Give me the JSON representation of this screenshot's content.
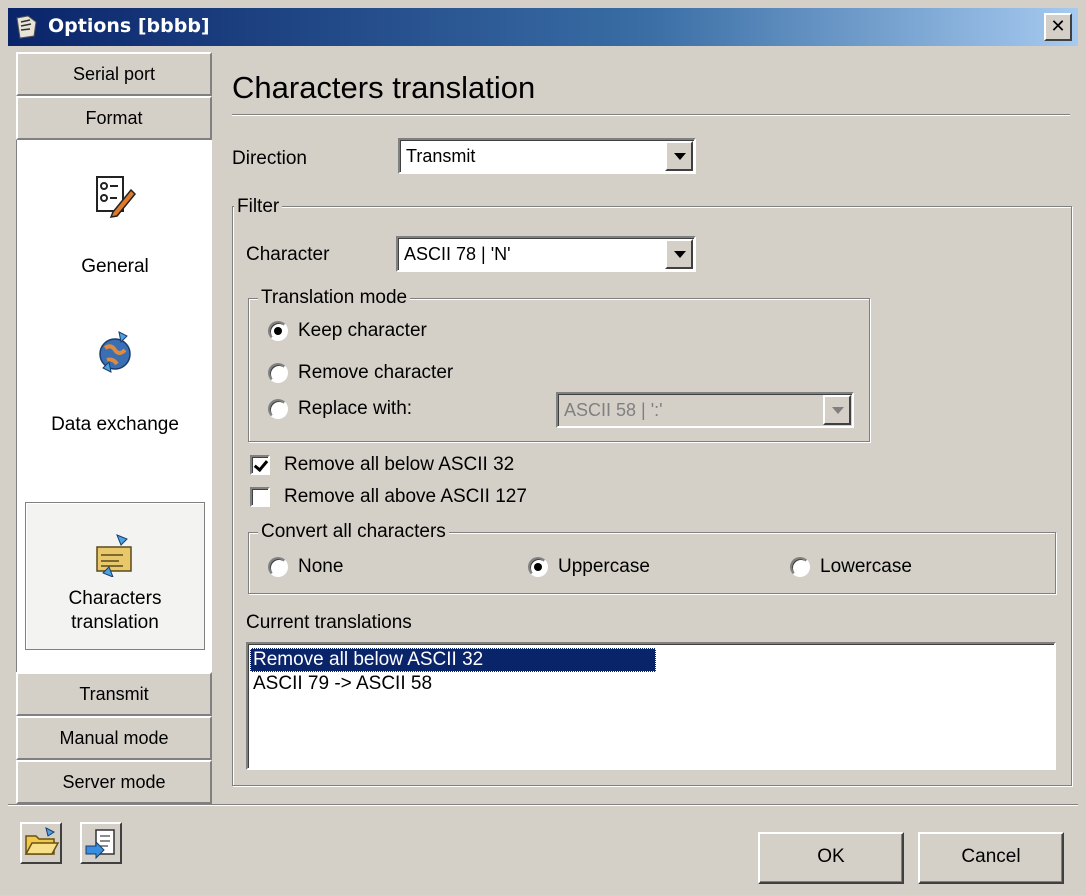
{
  "window": {
    "title": "Options [bbbb]",
    "close_glyph": "✕"
  },
  "nav": {
    "top_tabs": [
      {
        "label": "Serial port"
      },
      {
        "label": "Format"
      }
    ],
    "items": [
      {
        "label": "General",
        "icon": "checklist-pencil-icon"
      },
      {
        "label": "Data exchange",
        "icon": "globe-arrows-icon"
      },
      {
        "label": "Characters translation",
        "icon": "document-arrows-icon",
        "selected": true
      }
    ],
    "bottom_tabs": [
      {
        "label": "Transmit"
      },
      {
        "label": "Manual mode"
      },
      {
        "label": "Server mode"
      }
    ]
  },
  "main": {
    "title": "Characters translation",
    "direction": {
      "label": "Direction",
      "value": "Transmit"
    },
    "filter": {
      "caption": "Filter",
      "character": {
        "label": "Character",
        "value": "ASCII 78 | 'N'"
      },
      "translation_mode": {
        "caption": "Translation mode",
        "options": [
          {
            "label": "Keep character",
            "selected": true
          },
          {
            "label": "Remove character",
            "selected": false
          },
          {
            "label": "Replace with:",
            "selected": false
          }
        ],
        "replace_value": "ASCII 58 | ':'"
      },
      "remove_below": {
        "label": "Remove all below ASCII 32",
        "checked": true
      },
      "remove_above": {
        "label": "Remove all above ASCII 127",
        "checked": false
      },
      "convert": {
        "caption": "Convert all characters",
        "options": [
          {
            "label": "None",
            "selected": false
          },
          {
            "label": "Uppercase",
            "selected": true
          },
          {
            "label": "Lowercase",
            "selected": false
          }
        ]
      },
      "current_translations": {
        "label": "Current translations",
        "items": [
          "Remove all below ASCII 32",
          "ASCII 79 -> ASCII 58"
        ],
        "selected_index": 0
      }
    }
  },
  "footer": {
    "tools": [
      {
        "icon": "open-folder-icon"
      },
      {
        "icon": "export-document-icon"
      }
    ],
    "ok_label": "OK",
    "cancel_label": "Cancel"
  },
  "colors": {
    "face": "#d4d0c8",
    "titlebar": "#0a246a",
    "selection": "#0a246a"
  }
}
